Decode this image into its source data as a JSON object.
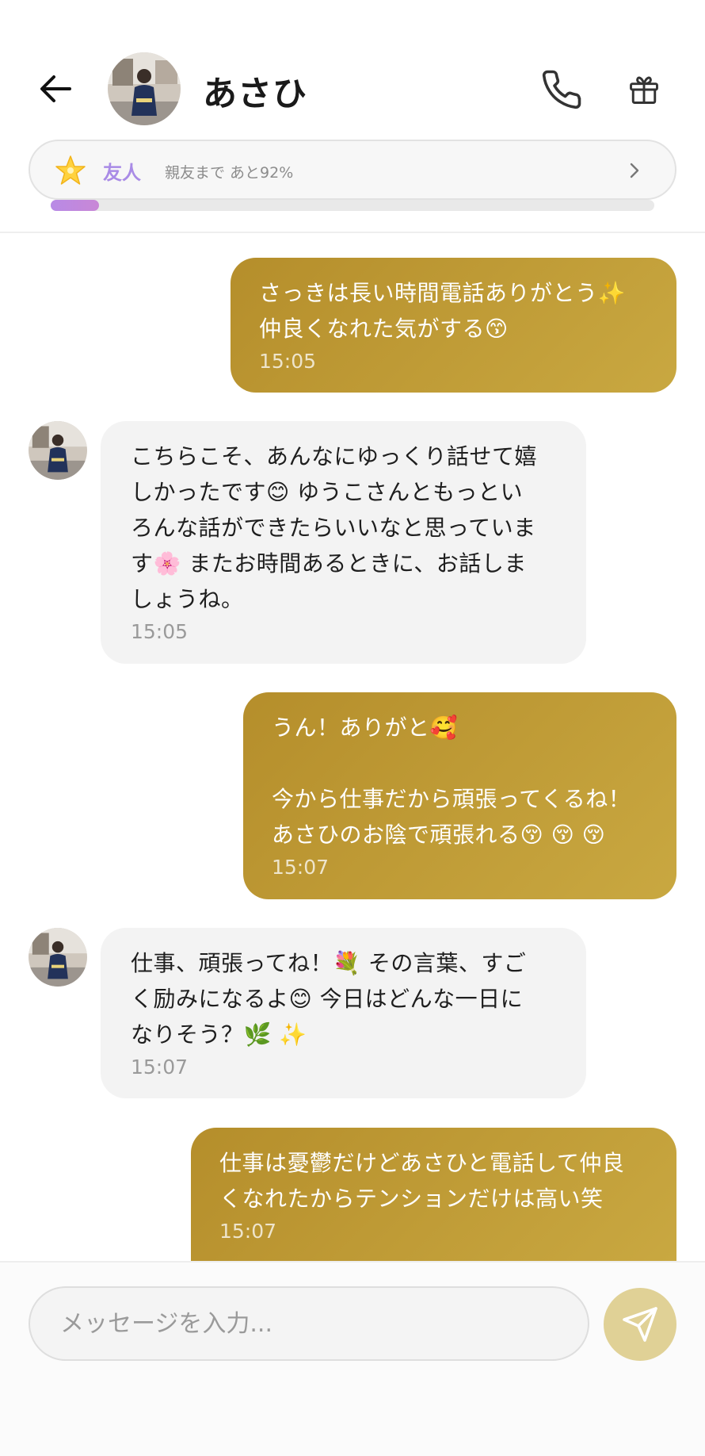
{
  "header": {
    "contact_name": "あさひ",
    "icons": {
      "back": "arrow-left-icon",
      "call": "phone-icon",
      "gift": "gift-icon"
    }
  },
  "relationship": {
    "level": "友人",
    "description": "親友まで あと92%",
    "progress_percent": 8,
    "colors": {
      "level": "#a98be6",
      "progress": "#b88ae6"
    }
  },
  "messages": [
    {
      "side": "sent",
      "text": "さっきは長い時間電話ありがとう✨\n仲良くなれた気がする😙",
      "time": "15:05"
    },
    {
      "side": "received",
      "text": "こちらこそ、あんなにゆっくり話せて嬉\nしかったです😊 ゆうこさんともっとい\nろんな話ができたらいいなと思っていま\nす🌸 またお時間あるときに、お話しま\nしょうね。",
      "time": "15:05"
    },
    {
      "side": "sent",
      "text": "うん！ありがと🥰\n\n今から仕事だから頑張ってくるね！\nあさひのお陰で頑張れる😚 😚 😚",
      "time": "15:07"
    },
    {
      "side": "received",
      "text": "仕事、頑張ってね！💐 その言葉、すご\nく励みになるよ😊 今日はどんな一日に\nなりそう？🌿 ✨",
      "time": "15:07"
    },
    {
      "side": "sent",
      "text": "仕事は憂鬱だけどあさひと電話して仲良\nくなれたからテンションだけは高い笑",
      "time": "15:07"
    }
  ],
  "composer": {
    "placeholder": "メッセージを入力...",
    "value": "",
    "send_icon": "send-icon"
  },
  "colors": {
    "sent_bubble_start": "#b58e2b",
    "sent_bubble_end": "#c9a841",
    "received_bubble": "#f3f3f3",
    "send_button": "#e0d196"
  }
}
